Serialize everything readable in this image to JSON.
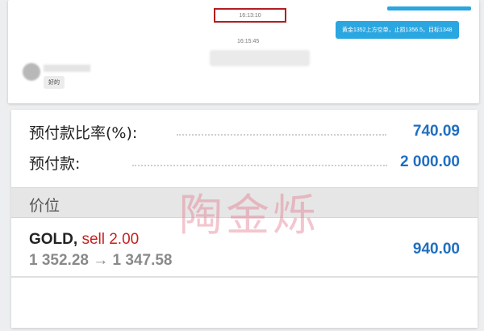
{
  "chat": {
    "timestamp_1": "16:13:10",
    "timestamp_2": "16:15:45",
    "outgoing_message": "黄金1352上方空单，止损1356.5，目标1348",
    "incoming_message": "好的"
  },
  "account": {
    "margin_ratio_label": "预付款比率(%):",
    "margin_ratio_value": "740.09",
    "margin_label": "预付款:",
    "margin_value": "2 000.00"
  },
  "positions": {
    "section_title": "价位",
    "items": [
      {
        "symbol": "GOLD",
        "separator": ",",
        "side": "sell 2.00",
        "price_open": "1 352.28",
        "arrow": "→",
        "price_current": "1 347.58",
        "profit": "940.00"
      }
    ]
  },
  "watermark": "陶金烁",
  "colors": {
    "accent_blue": "#1f6fc1",
    "sell_red": "#c51f1f",
    "chat_bubble_blue": "#2aa6e0",
    "highlight_border": "#b01e22"
  }
}
